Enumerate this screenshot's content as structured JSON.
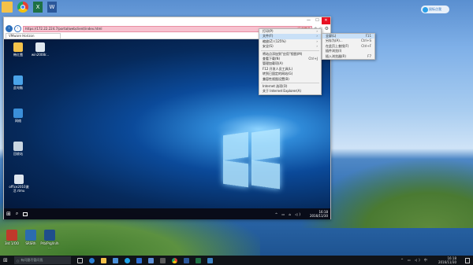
{
  "host_top_icons": [
    {
      "name": "folder",
      "color": "#f4c24a"
    },
    {
      "name": "chrome",
      "color": "#e34133"
    },
    {
      "name": "excel",
      "color": "#1e7145"
    },
    {
      "name": "word",
      "color": "#2b579a"
    }
  ],
  "host_desktop_icons": [
    {
      "name": "recycle",
      "label": "3rd 1/OO"
    },
    {
      "name": "computer",
      "label": "SRSRh"
    },
    {
      "name": "pdf",
      "label": "Prb/Prg/ln/h ..."
    }
  ],
  "notification": "鼠标点我",
  "ie": {
    "address": "https://172.22.224.7/portal/webclient/index.html",
    "cert_label": "证书错误",
    "tab_label": "VMware Horizon",
    "window_buttons": [
      "—",
      "☐",
      "✕"
    ]
  },
  "vm_desktop": {
    "icons": [
      {
        "name": "user-folder",
        "label": "韩红霞",
        "color": "#f4c24a"
      },
      {
        "name": "file",
        "label": "win2008r...",
        "color": "#dfe7ef"
      },
      {
        "name": "computer",
        "label": "此电脑",
        "color": "#4aa3e8"
      },
      {
        "name": "network",
        "label": "网络",
        "color": "#3b8fd9"
      },
      {
        "name": "recycle-bin",
        "label": "回收站",
        "color": "#c9d6e3"
      },
      {
        "name": "office-shortcut",
        "label": "office2010激活.rtmu",
        "color": "#dfe7ef"
      }
    ],
    "taskbar_time": "16:18",
    "taskbar_date": "2016/11/30"
  },
  "main_menu": [
    {
      "label": "打印(P)",
      "shortcut": "",
      "arrow": "›"
    },
    {
      "label": "文件(F)",
      "shortcut": "",
      "arrow": "›",
      "highlight": true
    },
    {
      "label": "缩放(Z) (125%)",
      "shortcut": "",
      "arrow": "›"
    },
    {
      "label": "安全(S)",
      "shortcut": "",
      "arrow": "›"
    },
    {
      "sep": true
    },
    {
      "label": "将站点添加到\"应用\"视图(M)",
      "shortcut": "",
      "arrow": ""
    },
    {
      "label": "查看下载(N)",
      "shortcut": "Ctrl+J",
      "arrow": ""
    },
    {
      "label": "管理加载项(A)",
      "shortcut": "",
      "arrow": ""
    },
    {
      "label": "F12 开发人员工具(L)",
      "shortcut": "",
      "arrow": ""
    },
    {
      "label": "转到已固定的网站(G)",
      "shortcut": "",
      "arrow": ""
    },
    {
      "label": "兼容性视图设置(B)",
      "shortcut": "",
      "arrow": ""
    },
    {
      "sep": true
    },
    {
      "label": "Internet 选项(O)",
      "shortcut": "",
      "arrow": ""
    },
    {
      "label": "关于 Internet Explorer(A)",
      "shortcut": "",
      "arrow": ""
    }
  ],
  "file_submenu": [
    {
      "label": "全屏(L)",
      "shortcut": "F11",
      "highlight": true
    },
    {
      "label": "另存为(A)...",
      "shortcut": "Ctrl+S"
    },
    {
      "label": "在此页上查找(F)",
      "shortcut": "Ctrl+F"
    },
    {
      "label": "插件浏览(I)",
      "shortcut": ""
    },
    {
      "label": "插入浏览器(R)",
      "shortcut": "F7"
    }
  ],
  "host_taskbar": {
    "search_placeholder": "有问题尽管问我",
    "icons": [
      "task-view",
      "edge",
      "explorer",
      "store",
      "ie",
      "mail",
      "photos",
      "vmware",
      "chrome",
      "word",
      "excel",
      "vm"
    ],
    "time": "16:18",
    "date": "2016/11/30"
  }
}
